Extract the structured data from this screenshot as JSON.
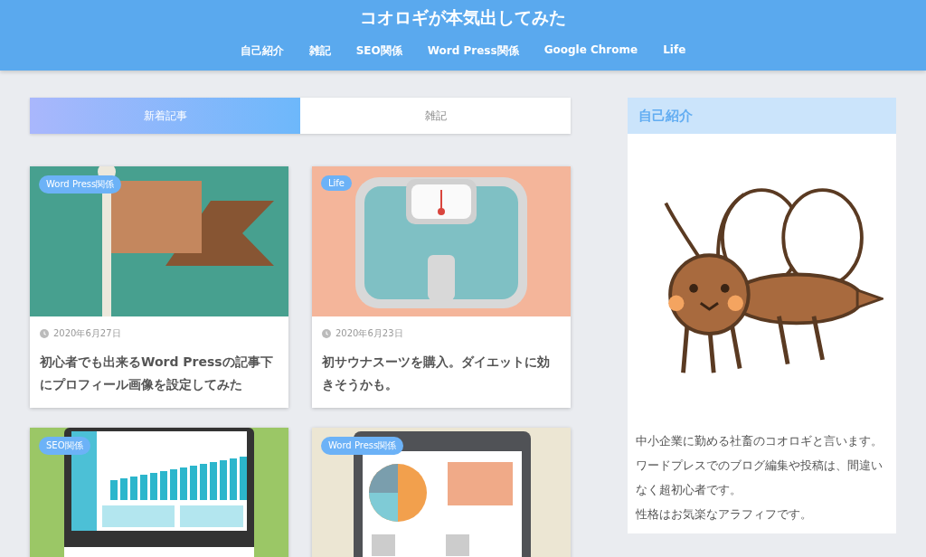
{
  "header": {
    "site_title": "コオロギが本気出してみた",
    "nav": [
      "自己紹介",
      "雑記",
      "SEO関係",
      "Word Press関係",
      "Google Chrome",
      "Life"
    ]
  },
  "tabs": [
    {
      "label": "新着記事",
      "selected": true
    },
    {
      "label": "雑記",
      "selected": false
    }
  ],
  "posts": [
    {
      "category": "Word Press関係",
      "date": "2020年6月27日",
      "title": "初心者でも出来るWord Pressの記事下にプロフィール画像を設定してみた"
    },
    {
      "category": "Life",
      "date": "2020年6月23日",
      "title": "初サウナスーツを購入。ダイエットに効きそうかも。"
    },
    {
      "category": "SEO関係"
    },
    {
      "category": "Word Press関係"
    }
  ],
  "sidebar": {
    "heading": "自己紹介",
    "paragraphs": [
      "中小企業に勤める社畜のコオロギと言います。",
      "ワードプレスでのブログ編集や投稿は、間違いなく超初心者です。",
      "性格はお気楽なアラフィフです。"
    ]
  }
}
